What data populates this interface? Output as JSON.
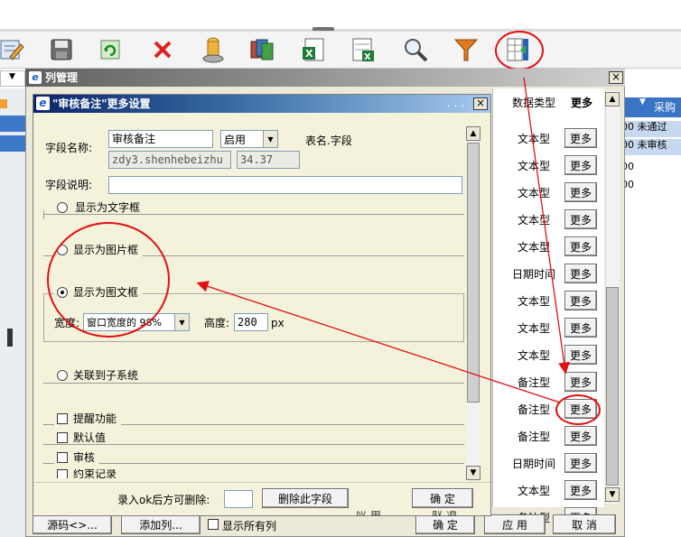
{
  "toolbar": {
    "icons": [
      "edit-icon",
      "save-icon",
      "refresh-icon",
      "delete-icon",
      "user-icon",
      "import-icon",
      "excel-export-icon",
      "excel-import-icon",
      "search-icon",
      "filter-icon",
      "column-manager-icon"
    ]
  },
  "column_manager": {
    "title": "列管理",
    "close_glyph": "×",
    "headers": {
      "data_type": "数据类型",
      "more": "更多"
    },
    "rows": [
      {
        "type": "文本型",
        "frag": ""
      },
      {
        "type": "文本型",
        "frag": ""
      },
      {
        "type": "文本型",
        "frag": ""
      },
      {
        "type": "文本型",
        "frag": ""
      },
      {
        "type": "文本型",
        "frag": ""
      },
      {
        "type": "日期时间",
        "frag": ""
      },
      {
        "type": "文本型",
        "frag": ""
      },
      {
        "type": "文本型",
        "frag": ""
      },
      {
        "type": "文本型",
        "frag": ""
      },
      {
        "type": "备注型",
        "frag": ""
      },
      {
        "type": "备注型",
        "frag": ""
      },
      {
        "type": "备注型",
        "frag": ""
      },
      {
        "type": "日期时间",
        "frag": ""
      },
      {
        "type": "文本型",
        "frag": ""
      },
      {
        "type": "备注型",
        "frag": ""
      }
    ],
    "more_label": "更多",
    "bottom": {
      "source_btn": "源码<>...",
      "add_col_btn": "添加列...",
      "show_all_label": "显示所有列",
      "ok_btn": "确 定",
      "apply_btn": "应 用",
      "cancel_btn": "取 消"
    }
  },
  "right_list": {
    "header": "采购",
    "rows": [
      {
        "prefix": "00",
        "text": "未通过"
      },
      {
        "prefix": "00",
        "text": "未审核"
      },
      {
        "prefix": "00",
        "text": ""
      },
      {
        "prefix": "00",
        "text": ""
      }
    ]
  },
  "dialog": {
    "title": "\"审核备注\"更多设置",
    "dots": ". . .",
    "close_glyph": "×",
    "field_name_label": "字段名称:",
    "field_name_value": "审核备注",
    "status_value": "启用",
    "table_field_label": "表名.字段",
    "table_field_value": "zdy3.shenhebeizhu",
    "size_value": "34.37",
    "desc_label": "字段说明:",
    "desc_value": "",
    "options": {
      "text_box": "显示为文字框",
      "image_box": "显示为图片框",
      "rich_text_box": "显示为图文框",
      "subsystem": "关联到子系统",
      "reminder": "提醒功能",
      "default_value": "默认值",
      "audit": "审核",
      "constraint": "约束记录"
    },
    "width_label": "宽度:",
    "width_value": "窗口宽度的 98%",
    "height_label": "高度:",
    "height_value": "280",
    "height_unit": "px",
    "delete_hint": "录入ok后方可删除:",
    "delete_btn": "删除此字段",
    "ok_btn": "确 定",
    "hidden_btn_1": "应 用",
    "hidden_btn_2": "取 消"
  },
  "annotations": {
    "color": "#e21010"
  }
}
